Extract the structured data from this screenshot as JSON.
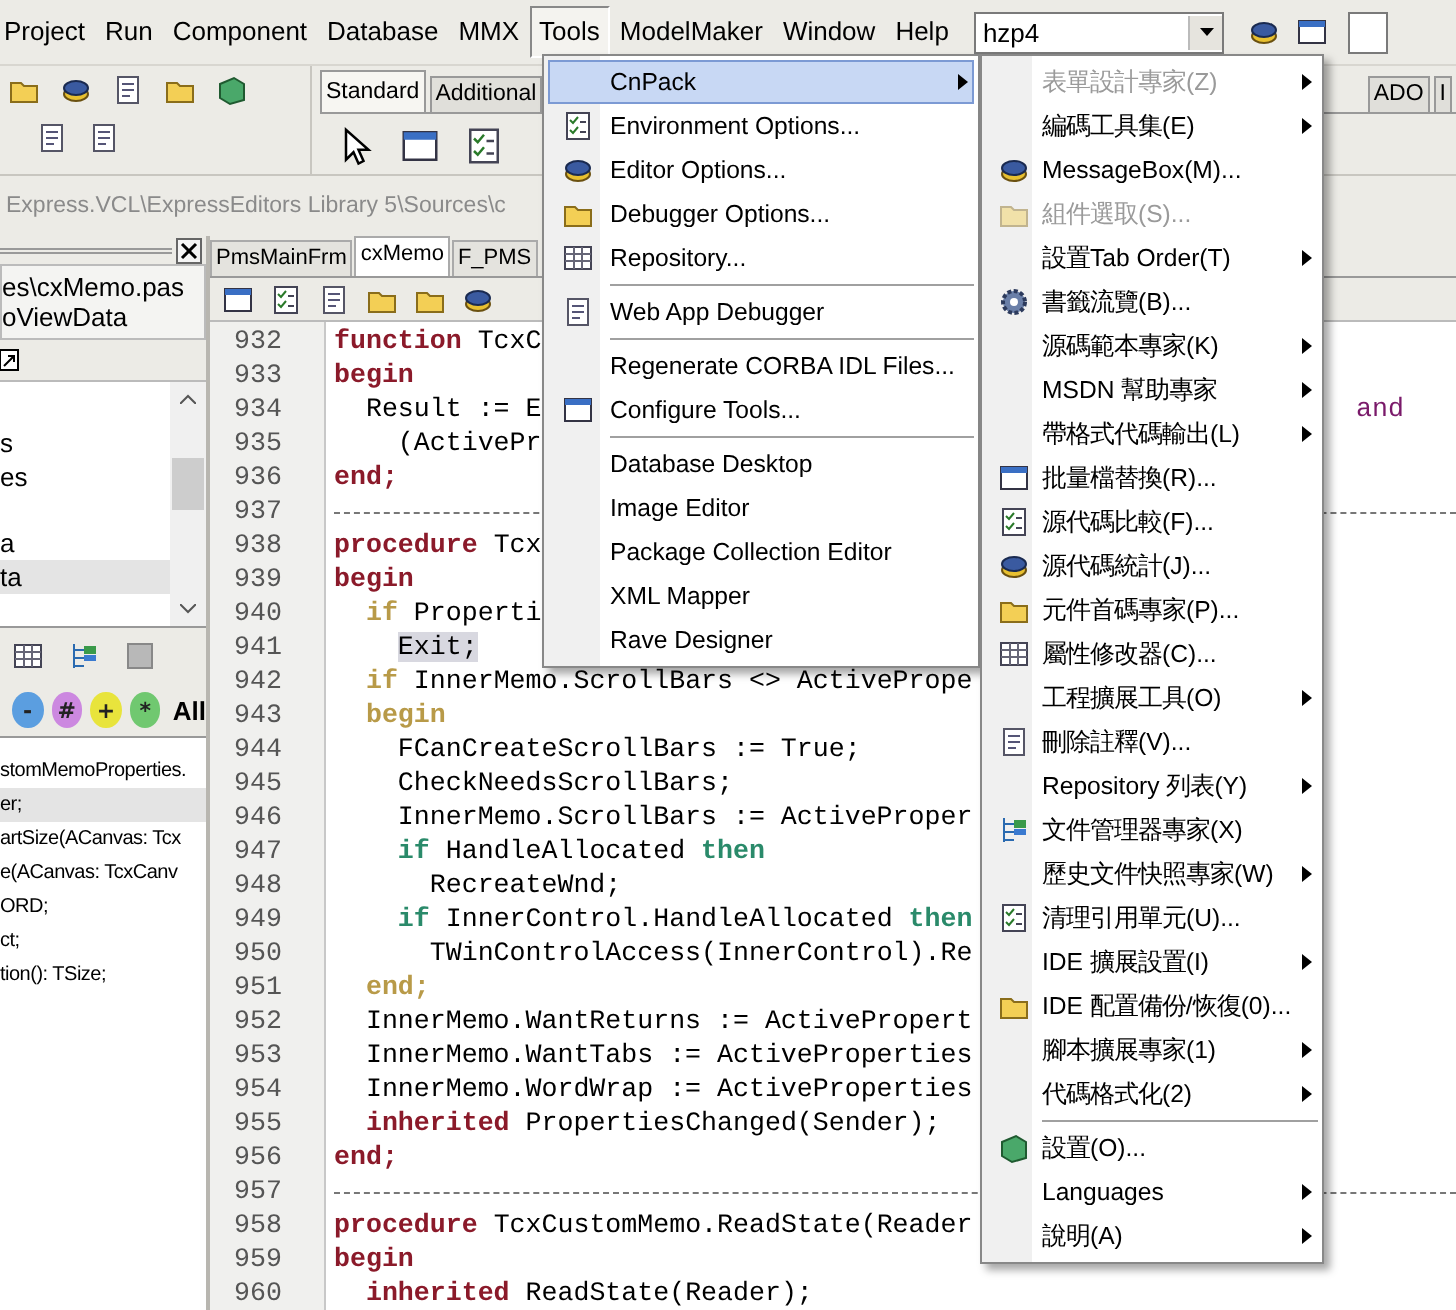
{
  "menubar": {
    "items": [
      {
        "label": "Project",
        "selected": false
      },
      {
        "label": "Run",
        "selected": false
      },
      {
        "label": "Component",
        "selected": false
      },
      {
        "label": "Database",
        "selected": false
      },
      {
        "label": "MMX",
        "selected": false
      },
      {
        "label": "Tools",
        "selected": true
      },
      {
        "label": "ModelMaker",
        "selected": false
      },
      {
        "label": "Window",
        "selected": false
      },
      {
        "label": "Help",
        "selected": false
      }
    ],
    "desktop_combo": {
      "value": "hzp4"
    }
  },
  "palette": {
    "tabs": [
      {
        "label": "Standard",
        "selected": true
      },
      {
        "label": "Additional",
        "selected": false
      }
    ],
    "right_tabs": [
      {
        "label": "ADO",
        "selected": false
      },
      {
        "label": "I",
        "selected": false
      }
    ]
  },
  "path_bar": {
    "text": "Express.VCL\\ExpressEditors Library 5\\Sources\\c"
  },
  "explorer": {
    "file_path": "es\\cxMemo.pas",
    "class_name": "oViewData",
    "tree": [
      {
        "label": "s",
        "selected": false
      },
      {
        "label": "es",
        "selected": false
      },
      {
        "label": "a",
        "selected": false
      },
      {
        "label": "ta",
        "selected": true
      }
    ],
    "filters": [
      {
        "label": "-",
        "color": "#5b9ee0"
      },
      {
        "label": "#",
        "color": "#cc88e0"
      },
      {
        "label": "+",
        "color": "#e8e43c"
      },
      {
        "label": "*",
        "color": "#70c870"
      }
    ],
    "filter_all": "All",
    "members": [
      {
        "label": "stomMemoProperties.",
        "selected": false
      },
      {
        "label": "er;",
        "selected": true
      },
      {
        "label": "artSize(ACanvas: Tcx",
        "selected": false
      },
      {
        "label": "e(ACanvas: TcxCanv",
        "selected": false
      },
      {
        "label": "ORD;",
        "selected": false
      },
      {
        "label": "ct;",
        "selected": false
      },
      {
        "label": "tion(): TSize;",
        "selected": false
      }
    ]
  },
  "editor": {
    "tabs": [
      {
        "label": "PmsMainFrm",
        "selected": false
      },
      {
        "label": "cxMemo",
        "selected": true
      },
      {
        "label": "F_PMS",
        "selected": false
      }
    ],
    "lines": [
      {
        "number": "932",
        "kind": "code",
        "tokens": [
          {
            "text": "function",
            "kind": "keyword"
          },
          {
            "text": " TcxC",
            "kind": "plain"
          }
        ]
      },
      {
        "number": "933",
        "kind": "code",
        "tokens": [
          {
            "text": "begin",
            "kind": "keyword"
          }
        ]
      },
      {
        "number": "934",
        "kind": "code",
        "tokens": [
          {
            "text": "  Result := E",
            "kind": "plain"
          }
        ],
        "tail": "and"
      },
      {
        "number": "935",
        "kind": "code",
        "tokens": [
          {
            "text": "    (ActivePr",
            "kind": "plain"
          }
        ]
      },
      {
        "number": "936",
        "kind": "code",
        "tokens": [
          {
            "text": "end;",
            "kind": "keyword"
          }
        ]
      },
      {
        "number": "937",
        "kind": "separator"
      },
      {
        "number": "938",
        "kind": "code",
        "tokens": [
          {
            "text": "procedure",
            "kind": "keyword"
          },
          {
            "text": " Tcx",
            "kind": "plain"
          }
        ]
      },
      {
        "number": "939",
        "kind": "code",
        "tokens": [
          {
            "text": "begin",
            "kind": "keyword"
          }
        ]
      },
      {
        "number": "940",
        "kind": "code",
        "tokens": [
          {
            "text": "  if",
            "kind": "block"
          },
          {
            "text": " Properti",
            "kind": "plain"
          }
        ]
      },
      {
        "number": "941",
        "kind": "code",
        "tokens": [
          {
            "text": "    Exit;",
            "kind": "match"
          }
        ]
      },
      {
        "number": "942",
        "kind": "code",
        "tokens": [
          {
            "text": "  if",
            "kind": "block"
          },
          {
            "text": " InnerMemo.ScrollBars <> ActivePrope",
            "kind": "plain"
          }
        ]
      },
      {
        "number": "943",
        "kind": "code",
        "tokens": [
          {
            "text": "  begin",
            "kind": "block"
          }
        ]
      },
      {
        "number": "944",
        "kind": "code",
        "tokens": [
          {
            "text": "    FCanCreateScrollBars := True;",
            "kind": "plain"
          }
        ]
      },
      {
        "number": "945",
        "kind": "code",
        "tokens": [
          {
            "text": "    CheckNeedsScrollBars;",
            "kind": "plain"
          }
        ]
      },
      {
        "number": "946",
        "kind": "code",
        "tokens": [
          {
            "text": "    InnerMemo.ScrollBars := ActiveProper",
            "kind": "plain"
          }
        ]
      },
      {
        "number": "947",
        "kind": "code",
        "tokens": [
          {
            "text": "    if",
            "kind": "condition"
          },
          {
            "text": " HandleAllocated ",
            "kind": "plain"
          },
          {
            "text": "then",
            "kind": "condition"
          }
        ]
      },
      {
        "number": "948",
        "kind": "code",
        "tokens": [
          {
            "text": "      RecreateWnd;",
            "kind": "plain"
          }
        ]
      },
      {
        "number": "949",
        "kind": "code",
        "tokens": [
          {
            "text": "    if",
            "kind": "condition"
          },
          {
            "text": " InnerControl.HandleAllocated ",
            "kind": "plain"
          },
          {
            "text": "then",
            "kind": "condition"
          }
        ]
      },
      {
        "number": "950",
        "kind": "code",
        "tokens": [
          {
            "text": "      TWinControlAccess(InnerControl).Re",
            "kind": "plain"
          }
        ]
      },
      {
        "number": "951",
        "kind": "code",
        "tokens": [
          {
            "text": "  end;",
            "kind": "block"
          }
        ]
      },
      {
        "number": "952",
        "kind": "code",
        "tokens": [
          {
            "text": "  InnerMemo.WantReturns := ActivePropert",
            "kind": "plain"
          }
        ]
      },
      {
        "number": "953",
        "kind": "code",
        "tokens": [
          {
            "text": "  InnerMemo.WantTabs := ActiveProperties",
            "kind": "plain"
          }
        ]
      },
      {
        "number": "954",
        "kind": "code",
        "tokens": [
          {
            "text": "  InnerMemo.WordWrap := ActiveProperties",
            "kind": "plain"
          }
        ]
      },
      {
        "number": "955",
        "kind": "code",
        "tokens": [
          {
            "text": "  inherited",
            "kind": "keyword"
          },
          {
            "text": " PropertiesChanged(Sender);",
            "kind": "plain"
          }
        ]
      },
      {
        "number": "956",
        "kind": "code",
        "tokens": [
          {
            "text": "end;",
            "kind": "keyword"
          }
        ]
      },
      {
        "number": "957",
        "kind": "separator"
      },
      {
        "number": "958",
        "kind": "code",
        "tokens": [
          {
            "text": "procedure",
            "kind": "keyword"
          },
          {
            "text": " TcxCustomMemo.ReadState(Reader",
            "kind": "plain"
          }
        ]
      },
      {
        "number": "959",
        "kind": "code",
        "tokens": [
          {
            "text": "begin",
            "kind": "keyword"
          }
        ]
      },
      {
        "number": "960",
        "kind": "code",
        "tokens": [
          {
            "text": "  inherited",
            "kind": "keyword"
          },
          {
            "text": " ReadState(Reader);",
            "kind": "plain"
          }
        ]
      }
    ]
  },
  "tools_menu": {
    "items": [
      {
        "kind": "item",
        "label": "CnPack",
        "selected": true,
        "submenu": true,
        "icon": false
      },
      {
        "kind": "item",
        "label": "Environment Options...",
        "selected": false,
        "submenu": false,
        "icon": true
      },
      {
        "kind": "item",
        "label": "Editor Options...",
        "selected": false,
        "submenu": false,
        "icon": true
      },
      {
        "kind": "item",
        "label": "Debugger Options...",
        "selected": false,
        "submenu": false,
        "icon": true
      },
      {
        "kind": "item",
        "label": "Repository...",
        "selected": false,
        "submenu": false,
        "icon": true
      },
      {
        "kind": "separator"
      },
      {
        "kind": "item",
        "label": "Web App Debugger",
        "selected": false,
        "submenu": false,
        "icon": true
      },
      {
        "kind": "separator"
      },
      {
        "kind": "item",
        "label": "Regenerate CORBA IDL Files...",
        "selected": false,
        "submenu": false,
        "icon": false
      },
      {
        "kind": "item",
        "label": "Configure Tools...",
        "selected": false,
        "submenu": false,
        "icon": true
      },
      {
        "kind": "separator"
      },
      {
        "kind": "item",
        "label": "Database Desktop",
        "selected": false,
        "submenu": false,
        "icon": false
      },
      {
        "kind": "item",
        "label": "Image Editor",
        "selected": false,
        "submenu": false,
        "icon": false
      },
      {
        "kind": "item",
        "label": "Package Collection Editor",
        "selected": false,
        "submenu": false,
        "icon": false
      },
      {
        "kind": "item",
        "label": "XML Mapper",
        "selected": false,
        "submenu": false,
        "icon": false
      },
      {
        "kind": "item",
        "label": "Rave Designer",
        "selected": false,
        "submenu": false,
        "icon": false
      }
    ]
  },
  "cnpack_menu": {
    "items": [
      {
        "kind": "item",
        "label": "表單設計專家(Z)",
        "selected": false,
        "disabled": true,
        "submenu": true,
        "icon": false
      },
      {
        "kind": "item",
        "label": "編碼工具集(E)",
        "selected": false,
        "disabled": false,
        "submenu": true,
        "icon": false
      },
      {
        "kind": "item",
        "label": "MessageBox(M)...",
        "selected": false,
        "disabled": false,
        "submenu": false,
        "icon": true
      },
      {
        "kind": "item",
        "label": "組件選取(S)...",
        "selected": false,
        "disabled": true,
        "submenu": false,
        "icon": true
      },
      {
        "kind": "item",
        "label": "設置Tab Order(T)",
        "selected": false,
        "disabled": false,
        "submenu": true,
        "icon": false
      },
      {
        "kind": "item",
        "label": "書籤流覽(B)...",
        "selected": false,
        "disabled": false,
        "submenu": false,
        "icon": true
      },
      {
        "kind": "item",
        "label": "源碼範本專家(K)",
        "selected": false,
        "disabled": false,
        "submenu": true,
        "icon": false
      },
      {
        "kind": "item",
        "label": "MSDN 幫助專家",
        "selected": false,
        "disabled": false,
        "submenu": true,
        "icon": false
      },
      {
        "kind": "item",
        "label": "帶格式代碼輸出(L)",
        "selected": false,
        "disabled": false,
        "submenu": true,
        "icon": false
      },
      {
        "kind": "item",
        "label": "批量檔替換(R)...",
        "selected": false,
        "disabled": false,
        "submenu": false,
        "icon": true
      },
      {
        "kind": "item",
        "label": "源代碼比較(F)...",
        "selected": false,
        "disabled": false,
        "submenu": false,
        "icon": true
      },
      {
        "kind": "item",
        "label": "源代碼統計(J)...",
        "selected": false,
        "disabled": false,
        "submenu": false,
        "icon": true
      },
      {
        "kind": "item",
        "label": "元件首碼專家(P)...",
        "selected": false,
        "disabled": false,
        "submenu": false,
        "icon": true
      },
      {
        "kind": "item",
        "label": "屬性修改器(C)...",
        "selected": false,
        "disabled": false,
        "submenu": false,
        "icon": true
      },
      {
        "kind": "item",
        "label": "工程擴展工具(O)",
        "selected": false,
        "disabled": false,
        "submenu": true,
        "icon": false
      },
      {
        "kind": "item",
        "label": "刪除註釋(V)...",
        "selected": false,
        "disabled": false,
        "submenu": false,
        "icon": true
      },
      {
        "kind": "item",
        "label": "Repository 列表(Y)",
        "selected": false,
        "disabled": false,
        "submenu": true,
        "icon": false
      },
      {
        "kind": "item",
        "label": "文件管理器專家(X)",
        "selected": false,
        "disabled": false,
        "submenu": false,
        "icon": true
      },
      {
        "kind": "item",
        "label": "歷史文件快照專家(W)",
        "selected": false,
        "disabled": false,
        "submenu": true,
        "icon": false
      },
      {
        "kind": "item",
        "label": "清理引用單元(U)...",
        "selected": false,
        "disabled": false,
        "submenu": false,
        "icon": true
      },
      {
        "kind": "item",
        "label": "IDE 擴展設置(I)",
        "selected": false,
        "disabled": false,
        "submenu": true,
        "icon": false
      },
      {
        "kind": "item",
        "label": "IDE 配置備份/恢復(0)...",
        "selected": false,
        "disabled": false,
        "submenu": false,
        "icon": true
      },
      {
        "kind": "item",
        "label": "腳本擴展專家(1)",
        "selected": false,
        "disabled": false,
        "submenu": true,
        "icon": false
      },
      {
        "kind": "item",
        "label": "代碼格式化(2)",
        "selected": false,
        "disabled": false,
        "submenu": true,
        "icon": false
      },
      {
        "kind": "separator"
      },
      {
        "kind": "item",
        "label": "設置(O)...",
        "selected": false,
        "disabled": false,
        "submenu": false,
        "icon": true
      },
      {
        "kind": "item",
        "label": "Languages",
        "selected": false,
        "disabled": false,
        "submenu": true,
        "icon": false
      },
      {
        "kind": "item",
        "label": "說明(A)",
        "selected": false,
        "disabled": false,
        "submenu": true,
        "icon": false
      }
    ]
  }
}
